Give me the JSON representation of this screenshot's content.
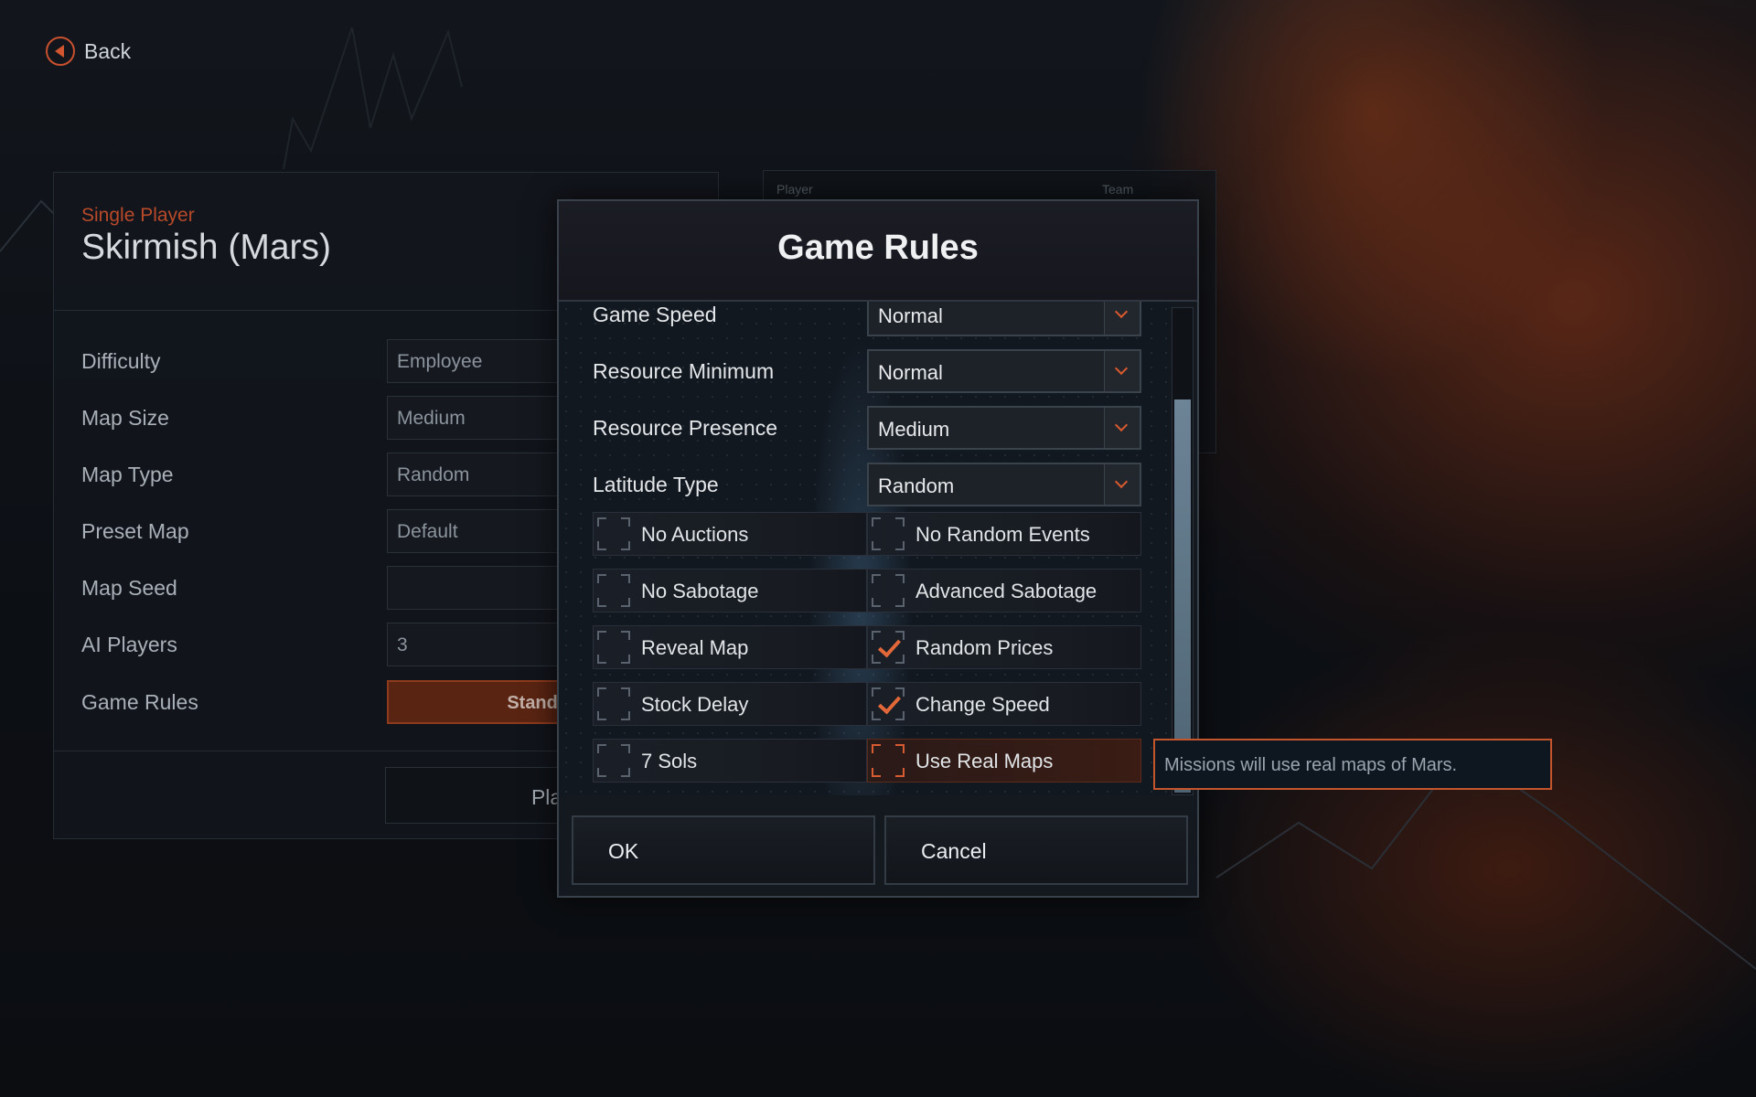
{
  "nav": {
    "back_label": "Back"
  },
  "setup": {
    "subtitle": "Single Player",
    "title": "Skirmish (Mars)",
    "rows": [
      {
        "label": "Difficulty",
        "value": "Employee"
      },
      {
        "label": "Map Size",
        "value": "Medium"
      },
      {
        "label": "Map Type",
        "value": "Random"
      },
      {
        "label": "Preset Map",
        "value": "Default"
      },
      {
        "label": "Map Seed",
        "value": ""
      },
      {
        "label": "AI Players",
        "value": "3"
      },
      {
        "label": "Game Rules",
        "value": "Standa"
      }
    ],
    "play_label": "Play G"
  },
  "players_panel": {
    "col_player": "Player",
    "col_team": "Team"
  },
  "dialog": {
    "title": "Game Rules",
    "dropdowns": [
      {
        "label": "Game Speed",
        "value": "Normal"
      },
      {
        "label": "Resource Minimum",
        "value": "Normal"
      },
      {
        "label": "Resource Presence",
        "value": "Medium"
      },
      {
        "label": "Latitude Type",
        "value": "Random"
      }
    ],
    "options": [
      {
        "label": "No Auctions",
        "checked": false
      },
      {
        "label": "No Random Events",
        "checked": false
      },
      {
        "label": "No Sabotage",
        "checked": false
      },
      {
        "label": "Advanced Sabotage",
        "checked": false
      },
      {
        "label": "Reveal Map",
        "checked": false
      },
      {
        "label": "Random Prices",
        "checked": true
      },
      {
        "label": "Stock Delay",
        "checked": false
      },
      {
        "label": "Change Speed",
        "checked": true
      },
      {
        "label": "7 Sols",
        "checked": false
      },
      {
        "label": "Use Real Maps",
        "checked": false,
        "hovered": true
      }
    ],
    "ok_label": "OK",
    "cancel_label": "Cancel"
  },
  "tooltip": {
    "text": "Missions will use real maps of Mars."
  },
  "colors": {
    "accent": "#d95a2e",
    "title": "#b84a2a"
  }
}
